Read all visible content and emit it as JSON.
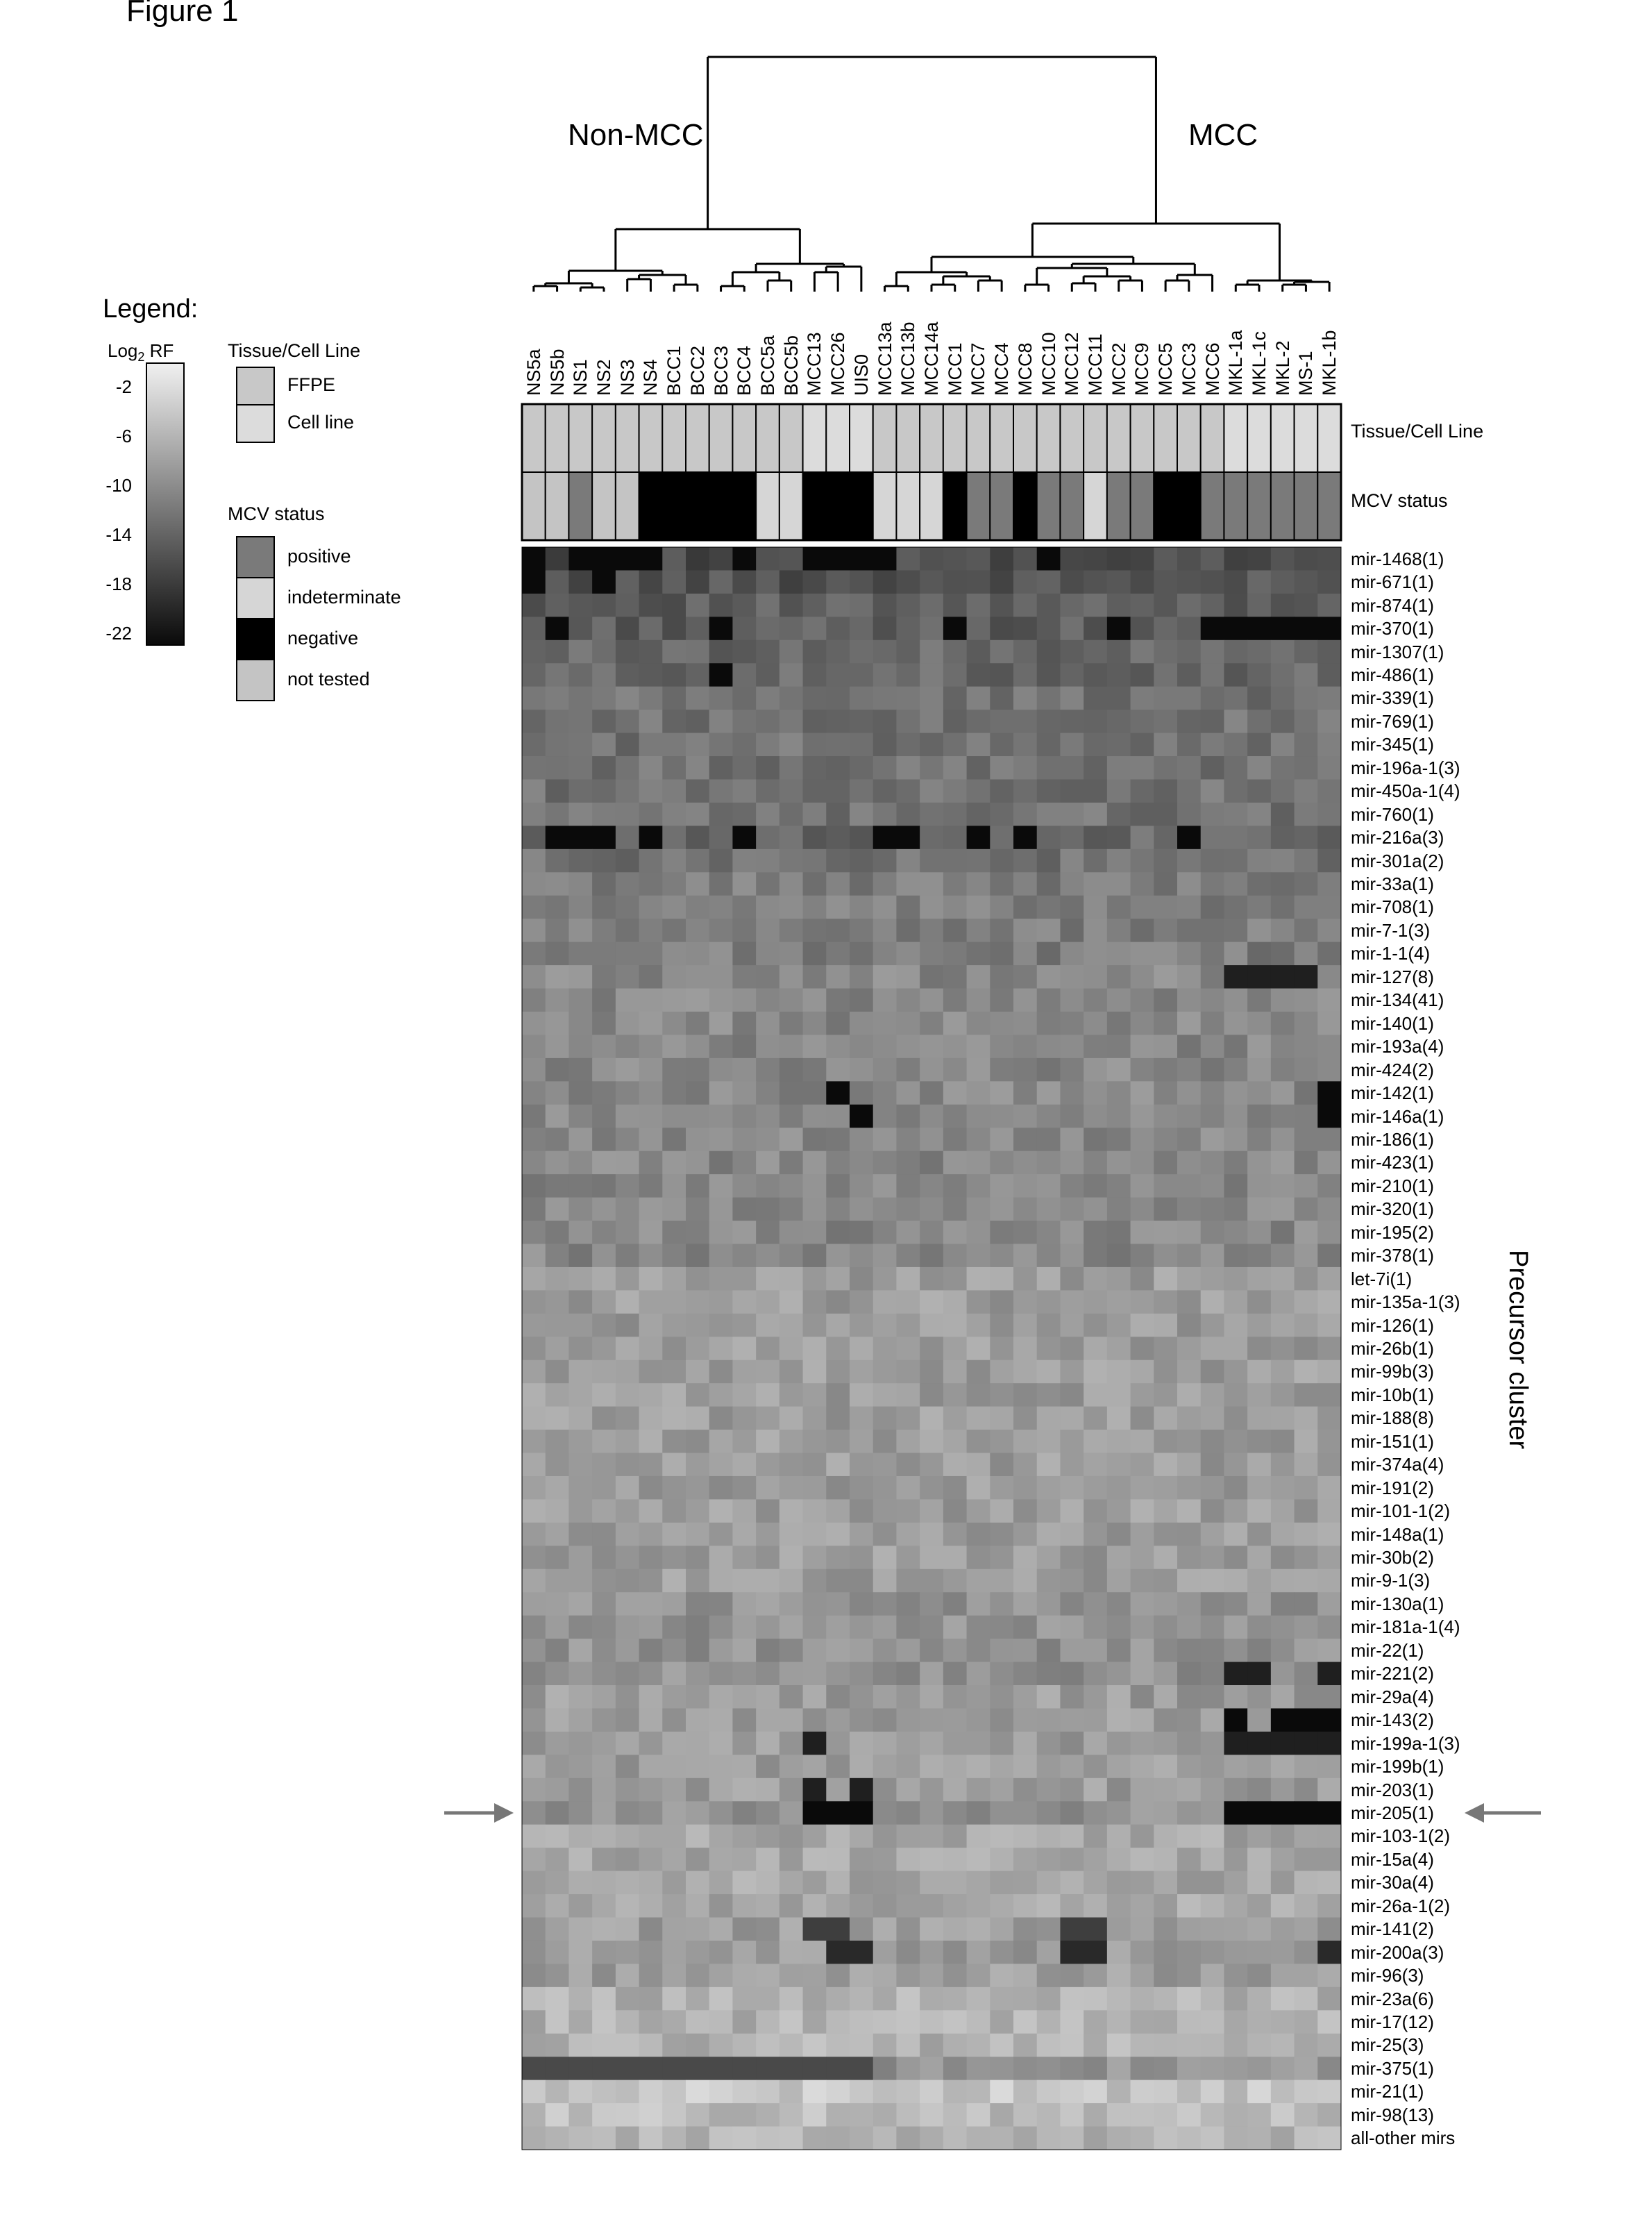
{
  "figure_title": "Figure 1",
  "legend": {
    "title": "Legend:",
    "colorbar_label": "Log",
    "colorbar_label_sub": "2",
    "colorbar_label_suffix": " RF",
    "colorbar_ticks": [
      "-2",
      "-6",
      "-10",
      "-14",
      "-18",
      "-22"
    ],
    "colorbar_range": [
      0,
      -23
    ],
    "tissue_title": "Tissue/Cell Line",
    "tissue_items": [
      {
        "label": "FFPE",
        "color": "#c8c8c8"
      },
      {
        "label": "Cell line",
        "color": "#dcdcdc"
      }
    ],
    "mcv_title": "MCV status",
    "mcv_items": [
      {
        "label": "positive",
        "color": "#7a7a7a"
      },
      {
        "label": "indeterminate",
        "color": "#d6d6d6"
      },
      {
        "label": "negative",
        "color": "#000000"
      },
      {
        "label": "not tested",
        "color": "#c4c4c4"
      }
    ]
  },
  "chart_data": {
    "type": "heatmap",
    "title": "Figure 1",
    "xlabel": "",
    "ylabel": "Precursor cluster",
    "value_label": "Log2 RF",
    "value_range": [
      -22,
      0
    ],
    "group_labels": {
      "left": "Non-MCC",
      "right": "MCC"
    },
    "annotation_row_labels": [
      "Tissue/Cell Line",
      "MCV status"
    ],
    "columns": [
      "NS5a",
      "NS5b",
      "NS1",
      "NS2",
      "NS3",
      "NS4",
      "BCC1",
      "BCC2",
      "BCC3",
      "BCC4",
      "BCC5a",
      "BCC5b",
      "MCC13",
      "MCC26",
      "UIS0",
      "MCC13a",
      "MCC13b",
      "MCC14a",
      "MCC1",
      "MCC7",
      "MCC4",
      "MCC8",
      "MCC10",
      "MCC12",
      "MCC11",
      "MCC2",
      "MCC9",
      "MCC5",
      "MCC3",
      "MCC6",
      "MKL-1a",
      "MKL-1c",
      "MKL-2",
      "MS-1",
      "MKL-1b"
    ],
    "tissue": [
      "FFPE",
      "FFPE",
      "FFPE",
      "FFPE",
      "FFPE",
      "FFPE",
      "FFPE",
      "FFPE",
      "FFPE",
      "FFPE",
      "FFPE",
      "FFPE",
      "Cell line",
      "Cell line",
      "Cell line",
      "FFPE",
      "FFPE",
      "FFPE",
      "FFPE",
      "FFPE",
      "FFPE",
      "FFPE",
      "FFPE",
      "FFPE",
      "FFPE",
      "FFPE",
      "FFPE",
      "FFPE",
      "FFPE",
      "FFPE",
      "Cell line",
      "Cell line",
      "Cell line",
      "Cell line",
      "Cell line"
    ],
    "mcv_status": [
      "not tested",
      "not tested",
      "positive",
      "not tested",
      "not tested",
      "negative",
      "negative",
      "negative",
      "negative",
      "negative",
      "indeterminate",
      "indeterminate",
      "negative",
      "negative",
      "negative",
      "indeterminate",
      "indeterminate",
      "indeterminate",
      "negative",
      "positive",
      "positive",
      "negative",
      "positive",
      "positive",
      "indeterminate",
      "positive",
      "positive",
      "negative",
      "negative",
      "positive",
      "positive",
      "positive",
      "positive",
      "positive",
      "positive"
    ],
    "rows": [
      "mir-1468(1)",
      "mir-671(1)",
      "mir-874(1)",
      "mir-370(1)",
      "mir-1307(1)",
      "mir-486(1)",
      "mir-339(1)",
      "mir-769(1)",
      "mir-345(1)",
      "mir-196a-1(3)",
      "mir-450a-1(4)",
      "mir-760(1)",
      "mir-216a(3)",
      "mir-301a(2)",
      "mir-33a(1)",
      "mir-708(1)",
      "mir-7-1(3)",
      "mir-1-1(4)",
      "mir-127(8)",
      "mir-134(41)",
      "mir-140(1)",
      "mir-193a(4)",
      "mir-424(2)",
      "mir-142(1)",
      "mir-146a(1)",
      "mir-186(1)",
      "mir-423(1)",
      "mir-210(1)",
      "mir-320(1)",
      "mir-195(2)",
      "mir-378(1)",
      "let-7i(1)",
      "mir-135a-1(3)",
      "mir-126(1)",
      "mir-26b(1)",
      "mir-99b(3)",
      "mir-10b(1)",
      "mir-188(8)",
      "mir-151(1)",
      "mir-374a(4)",
      "mir-191(2)",
      "mir-101-1(2)",
      "mir-148a(1)",
      "mir-30b(2)",
      "mir-9-1(3)",
      "mir-130a(1)",
      "mir-181a-1(4)",
      "mir-22(1)",
      "mir-221(2)",
      "mir-29a(4)",
      "mir-143(2)",
      "mir-199a-1(3)",
      "mir-199b(1)",
      "mir-203(1)",
      "mir-205(1)",
      "mir-103-1(2)",
      "mir-15a(4)",
      "mir-30a(4)",
      "mir-26a-1(2)",
      "mir-141(2)",
      "mir-200a(3)",
      "mir-96(3)",
      "mir-23a(6)",
      "mir-17(12)",
      "mir-25(3)",
      "mir-375(1)",
      "mir-21(1)",
      "mir-98(13)",
      "all-other mirs"
    ],
    "row_baseline": [
      -16,
      -15,
      -14,
      -14,
      -13,
      -13,
      -12,
      -12,
      -12,
      -12,
      -12,
      -12,
      -13,
      -12,
      -11,
      -11,
      -11,
      -11,
      -10,
      -10,
      -10,
      -10,
      -10,
      -10,
      -10,
      -10,
      -10,
      -10,
      -10,
      -10,
      -10,
      -8,
      -8,
      -8,
      -8,
      -8,
      -8,
      -8,
      -8,
      -8,
      -8,
      -8,
      -8,
      -8,
      -8,
      -9,
      -9,
      -9,
      -9,
      -8,
      -8,
      -8,
      -8,
      -8,
      -9,
      -7,
      -7,
      -7,
      -7,
      -8,
      -8,
      -8,
      -6,
      -6,
      -6,
      -9,
      -4,
      -5,
      -6
    ],
    "highlights": [
      {
        "row": "mir-1468(1)",
        "cols": [
          "NS5a",
          "NS1",
          "NS2",
          "NS3",
          "NS4",
          "BCC4",
          "MCC13",
          "MCC26",
          "UIS0",
          "MCC13a",
          "MCC10"
        ],
        "value": -22
      },
      {
        "row": "mir-671(1)",
        "cols": [
          "NS5a",
          "NS2"
        ],
        "value": -22
      },
      {
        "row": "mir-370(1)",
        "cols": [
          "NS5b",
          "BCC3",
          "MCC1",
          "MCC2",
          "MCC6",
          "MKL-1a",
          "MKL-1c",
          "MKL-2",
          "MS-1",
          "MKL-1b"
        ],
        "value": -22
      },
      {
        "row": "mir-486(1)",
        "cols": [
          "BCC3"
        ],
        "value": -22
      },
      {
        "row": "mir-216a(3)",
        "cols": [
          "NS5b",
          "NS1",
          "NS2",
          "NS4",
          "BCC4",
          "MCC13a",
          "MCC13b",
          "MCC7",
          "MCC8",
          "MCC3"
        ],
        "value": -22
      },
      {
        "row": "mir-127(8)",
        "cols": [
          "MKL-1a",
          "MKL-1c",
          "MKL-2",
          "MS-1"
        ],
        "value": -20
      },
      {
        "row": "mir-142(1)",
        "cols": [
          "MCC26",
          "MKL-1b"
        ],
        "value": -22
      },
      {
        "row": "mir-146a(1)",
        "cols": [
          "UIS0",
          "MKL-1b"
        ],
        "value": -22
      },
      {
        "row": "mir-221(2)",
        "cols": [
          "MKL-1a",
          "MKL-1c",
          "MKL-1b"
        ],
        "value": -20
      },
      {
        "row": "mir-143(2)",
        "cols": [
          "MKL-1a",
          "MKL-2",
          "MS-1",
          "MKL-1b"
        ],
        "value": -22
      },
      {
        "row": "mir-199a-1(3)",
        "cols": [
          "MCC13",
          "MKL-1a",
          "MKL-1c",
          "MKL-2",
          "MS-1",
          "MKL-1b"
        ],
        "value": -20
      },
      {
        "row": "mir-203(1)",
        "cols": [
          "MCC13",
          "UIS0"
        ],
        "value": -20
      },
      {
        "row": "mir-205(1)",
        "cols": [
          "MCC13",
          "MCC26",
          "UIS0",
          "MKL-1a",
          "MKL-1c",
          "MKL-2",
          "MS-1",
          "MKL-1b"
        ],
        "value": -22
      },
      {
        "row": "mir-141(2)",
        "cols": [
          "MCC13",
          "MCC26",
          "MCC12",
          "MCC11"
        ],
        "value": -17
      },
      {
        "row": "mir-200a(3)",
        "cols": [
          "MCC26",
          "UIS0",
          "MCC12",
          "MCC11",
          "MKL-1b"
        ],
        "value": -19
      },
      {
        "row": "mir-375(1)",
        "cols": [
          "NS5a",
          "NS5b",
          "NS1",
          "NS2",
          "NS3",
          "NS4",
          "BCC1",
          "BCC2",
          "BCC3",
          "BCC4",
          "BCC5a",
          "BCC5b",
          "MCC13",
          "MCC26",
          "UIS0"
        ],
        "value": -16
      }
    ],
    "annotations": [
      {
        "type": "arrow",
        "row": "mir-205(1)",
        "side": "left"
      },
      {
        "type": "arrow",
        "row": "mir-205(1)",
        "side": "right"
      }
    ]
  },
  "labels": {
    "non_mcc": "Non-MCC",
    "mcc": "MCC",
    "tissue_row": "Tissue/Cell Line",
    "mcv_row": "MCV status",
    "y_axis": "Precursor cluster"
  }
}
